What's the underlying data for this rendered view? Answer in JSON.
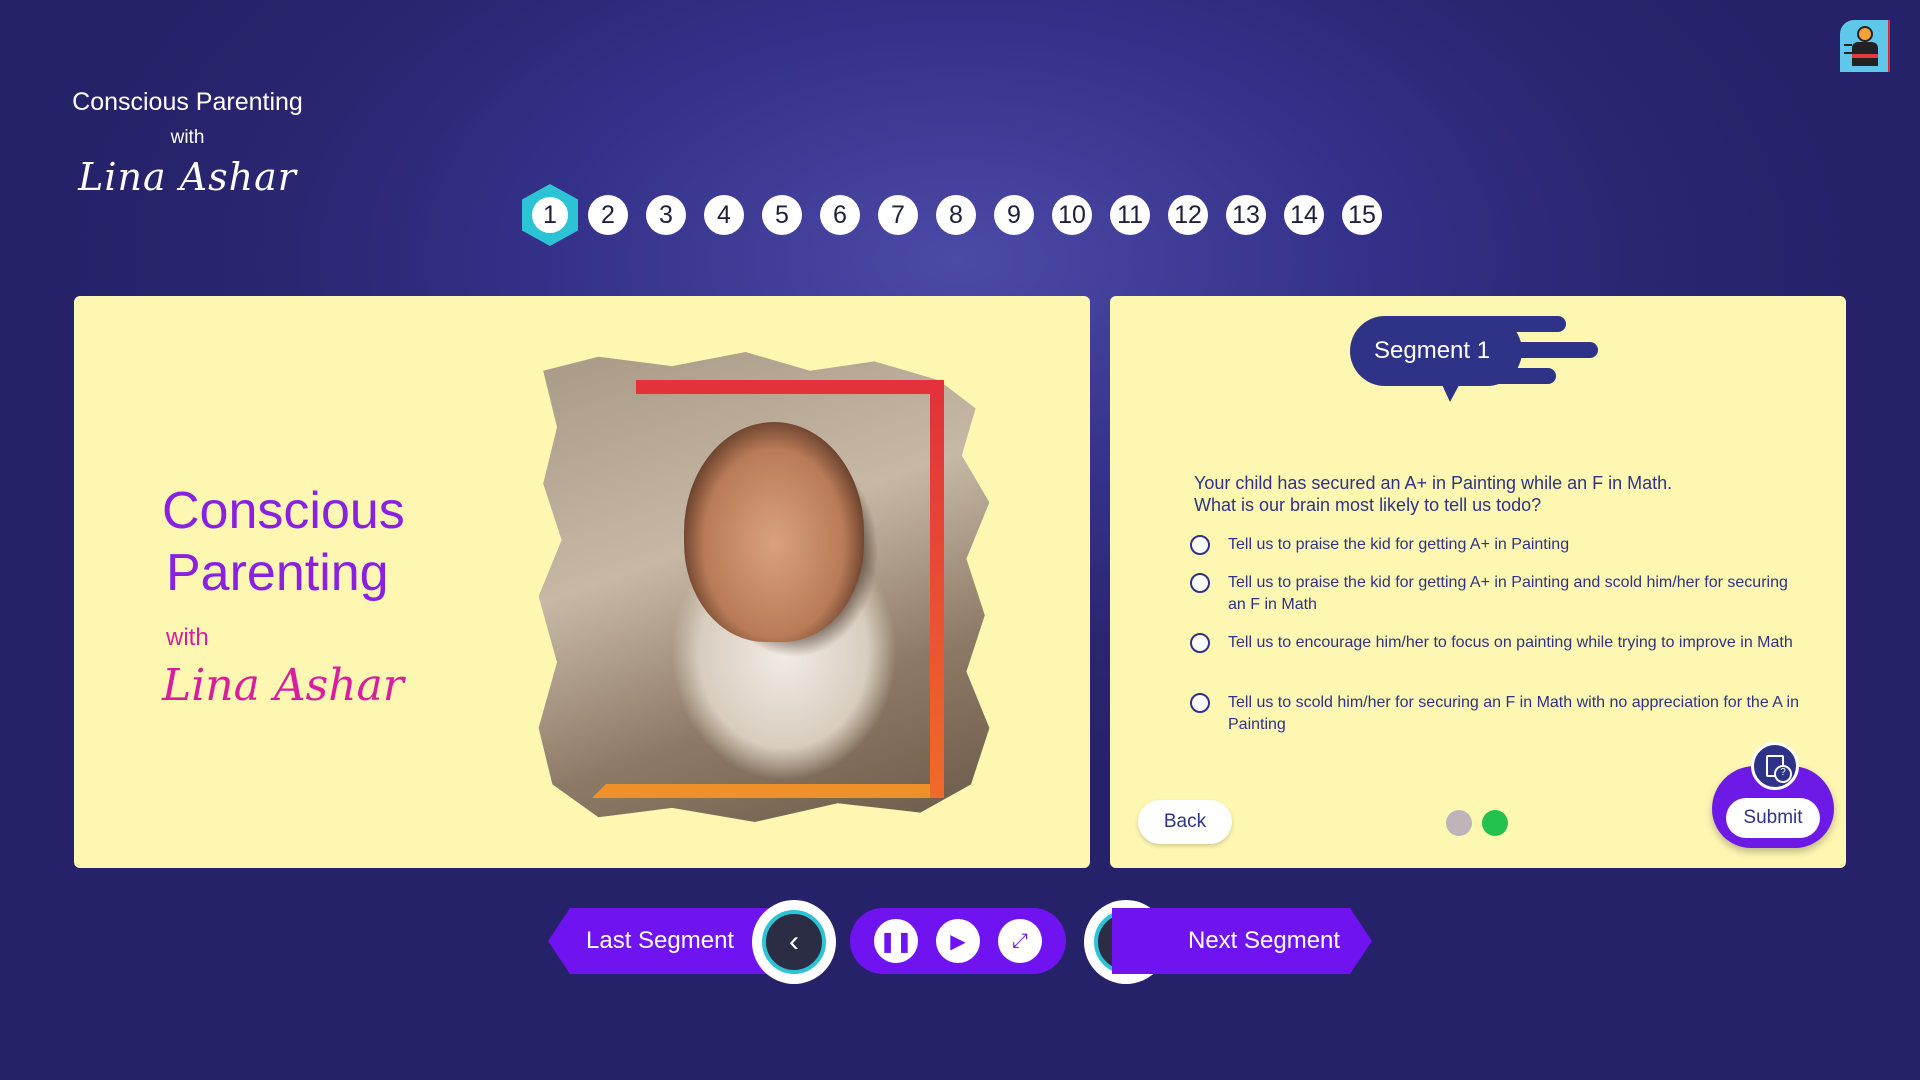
{
  "brand": {
    "title": "Conscious Parenting",
    "with": "with",
    "signature": "Lina Ashar"
  },
  "steps": [
    "1",
    "2",
    "3",
    "4",
    "5",
    "6",
    "7",
    "8",
    "9",
    "10",
    "11",
    "12",
    "13",
    "14",
    "15"
  ],
  "active_step": "1",
  "slide": {
    "title_line1": "Conscious",
    "title_line2": "Parenting",
    "with": "with",
    "signature": "Lina Ashar"
  },
  "segment": {
    "label": "Segment 1",
    "question_line1": "Your child has secured an A+ in Painting while an F in Math.",
    "question_line2": "What is our brain most likely to tell us todo?",
    "options": [
      "Tell us to praise the kid for getting A+ in Painting",
      "Tell us to praise the kid for getting A+ in Painting and scold him/her for securing an F in Math",
      "Tell us to encourage him/her to focus on painting while trying to improve in Math",
      "Tell us to scold him/her for securing an F in Math with no appreciation for the A in Painting"
    ],
    "back_label": "Back",
    "submit_label": "Submit"
  },
  "controls": {
    "last_segment": "Last Segment",
    "next_segment": "Next Segment",
    "prev_icon": "chevron-left-icon",
    "next_icon": "chevron-right-icon",
    "pause_icon": "pause-icon",
    "play_icon": "play-icon",
    "fullscreen_icon": "fullscreen-icon"
  },
  "colors": {
    "accent": "#6f14f0",
    "navy": "#2e3388",
    "panel": "#fef7b2",
    "teal": "#2cc4d4",
    "title_purple": "#8a21e0",
    "title_pink": "#d81e9e",
    "dot_active": "#22c24d",
    "dot_inactive": "#bdb5b9"
  }
}
